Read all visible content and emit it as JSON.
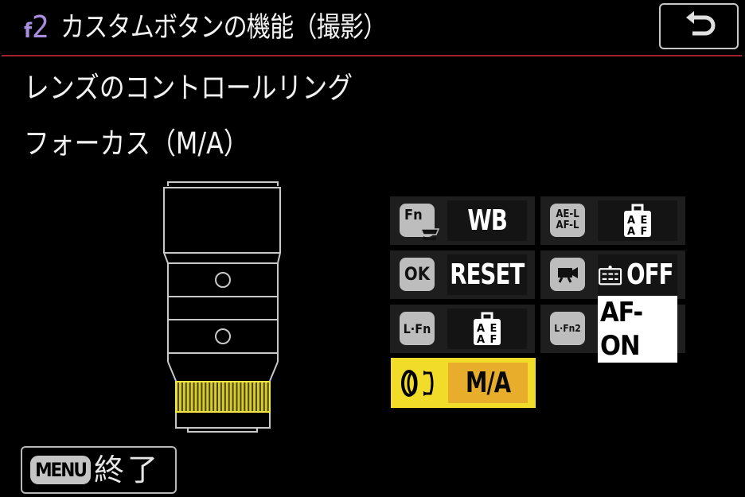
{
  "header": {
    "menu_code_letter": "f",
    "menu_code_number": "2",
    "title": "カスタムボタンの機能（撮影）",
    "back_label": "back"
  },
  "setting": {
    "name": "レンズのコントロールリング",
    "value": "フォーカス（M/A）"
  },
  "assignments": [
    {
      "control": "Fn",
      "control_icon": "fn-button-icon",
      "value": "WB",
      "value_icon": null,
      "selected": false
    },
    {
      "control": "AE-L/AF-L",
      "control_icon": "ae-l-af-l-button-icon",
      "value": "AE/AF lock",
      "value_icon": "ae-af-lock-icon",
      "selected": false
    },
    {
      "control": "OK",
      "control_icon": "ok-button-icon",
      "value": "RESET",
      "value_icon": null,
      "selected": false
    },
    {
      "control": "Movie record",
      "control_icon": "movie-record-button-icon",
      "value": "OFF",
      "value_icon": "camera-off-icon",
      "selected": false
    },
    {
      "control": "L-Fn",
      "control_icon": "l-fn-button-icon",
      "value": "AE/AF lock",
      "value_icon": "ae-af-lock-icon",
      "selected": false
    },
    {
      "control": "L-Fn2",
      "control_icon": "l-fn2-button-icon",
      "value": "AF-ON",
      "value_icon": null,
      "selected": false
    },
    {
      "control": "Lens control ring",
      "control_icon": "control-ring-icon",
      "value": "M/A",
      "value_icon": null,
      "selected": true
    }
  ],
  "labels": {
    "fn": "Fn",
    "ok": "OK",
    "aell1": "AE-L",
    "aell2": "AF-L",
    "lfn": "L·Fn",
    "lfn2": "L·Fn2",
    "wb": "WB",
    "reset": "RESET",
    "off": "OFF",
    "afon": "AF-ON",
    "ma": "M/A",
    "lock_a1": "A",
    "lock_e": "E",
    "lock_a2": "A",
    "lock_f": "F"
  },
  "footer": {
    "menu_badge": "MENU",
    "exit_label": "終了"
  },
  "colors": {
    "accent_rule": "#a0202e",
    "menu_code": "#a98ee0",
    "selected_cell": "#f2dc2a",
    "selected_value": "#e8ad2a",
    "ring_highlight": "#e8dc2a"
  }
}
